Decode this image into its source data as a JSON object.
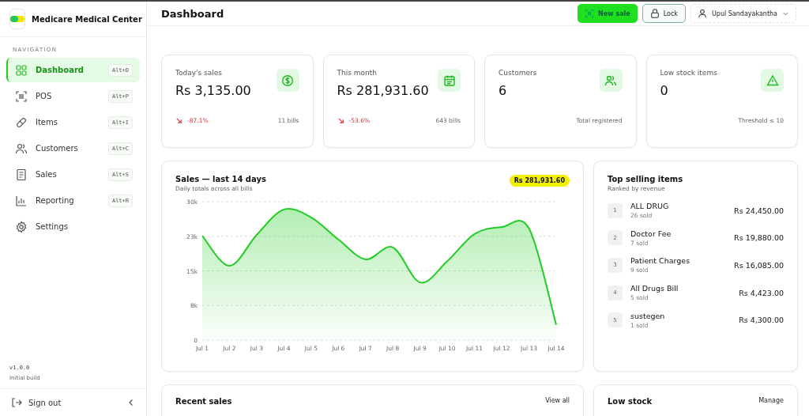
{
  "sidebar": {
    "brand": "Medicare Medical Center",
    "section": "NAVIGATION",
    "items": [
      {
        "label": "Dashboard",
        "shortcut": "Alt+D",
        "selected": true
      },
      {
        "label": "POS",
        "shortcut": "Alt+P",
        "selected": false
      },
      {
        "label": "Items",
        "shortcut": "Alt+I",
        "selected": false
      },
      {
        "label": "Customers",
        "shortcut": "Alt+C",
        "selected": false
      },
      {
        "label": "Sales",
        "shortcut": "Alt+S",
        "selected": false
      },
      {
        "label": "Reporting",
        "shortcut": "Alt+R",
        "selected": false
      },
      {
        "label": "Settings",
        "selected": false
      }
    ],
    "version": "v1.0.0",
    "build": "Initial build",
    "sign_out": "Sign out"
  },
  "header": {
    "title": "Dashboard",
    "new_sale": "New sale",
    "lock": "Lock",
    "user": "Upul Sandayakantha"
  },
  "stats": [
    {
      "label": "Today's sales",
      "value": "Rs 3,135.00",
      "change": "-87.1%",
      "falling": true,
      "note": "11 bills"
    },
    {
      "label": "This month",
      "value": "Rs 281,931.60",
      "change": "-53.6%",
      "falling": true,
      "note": "643 bills"
    },
    {
      "label": "Customers",
      "value": "6",
      "note": "Total registered"
    },
    {
      "label": "Low stock items",
      "value": "0",
      "note": "Threshold ≤ 10"
    }
  ],
  "sales_chart": {
    "title": "Sales — last 14 days",
    "subtitle": "Daily totals across all bills",
    "total": "Rs 281,931.60",
    "chart_data": {
      "type": "area",
      "categories": [
        "Jul 1",
        "Jul 2",
        "Jul 3",
        "Jul 4",
        "Jul 5",
        "Jul 6",
        "Jul 7",
        "Jul 8",
        "Jul 9",
        "Jul 10",
        "Jul 11",
        "Jul 12",
        "Jul 13",
        "Jul 14"
      ],
      "grid": true,
      "series": [
        {
          "color": "#22cc22",
          "values": [
            22600,
            16100,
            22800,
            28300,
            26600,
            21800,
            17500,
            20100,
            12500,
            17100,
            23000,
            24500,
            24200,
            3300
          ]
        }
      ],
      "ylim": [
        0,
        30000
      ],
      "yticks": [
        {
          "value": 0,
          "label": "0"
        },
        {
          "value": 7500,
          "label": "8k"
        },
        {
          "value": 15000,
          "label": "15k"
        },
        {
          "value": 22500,
          "label": "23k"
        },
        {
          "value": 30000,
          "label": "30k"
        }
      ]
    }
  },
  "top_selling": {
    "title": "Top selling items",
    "subtitle": "Ranked by revenue",
    "items": [
      {
        "rank": "1",
        "name": "ALL DRUG",
        "sold": "26 sold",
        "amount": "Rs 24,450.00"
      },
      {
        "rank": "2",
        "name": "Doctor Fee",
        "sold": "7 sold",
        "amount": "Rs 19,880.00"
      },
      {
        "rank": "3",
        "name": "Patient Charges",
        "sold": "9 sold",
        "amount": "Rs 16,085.00"
      },
      {
        "rank": "4",
        "name": "All Drugs Bill",
        "sold": "5 sold",
        "amount": "Rs 4,423.00"
      },
      {
        "rank": "5",
        "name": "sustegen",
        "sold": "1 sold",
        "amount": "Rs 4,300.00"
      }
    ]
  },
  "recent_sales": {
    "title": "Recent sales",
    "link": "View all"
  },
  "low_stock": {
    "title": "Low stock",
    "link": "Manage"
  }
}
